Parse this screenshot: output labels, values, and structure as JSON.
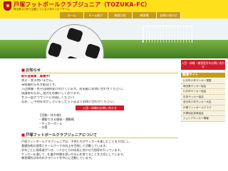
{
  "header": {
    "title": "戸塚フットボールクラブジュニア（TOZUKA-FC）",
    "subtitle": "埼玉県川口市で活動している少年サッカーチーム"
  },
  "nav": {
    "items": [
      "ホーム",
      "チーム紹介",
      "練習日程",
      "練習場",
      "お問い合わせ"
    ]
  },
  "news": {
    "heading": "お知らせ",
    "lines": [
      {
        "text": "新年度募集　募集中!",
        "title": true
      },
      {
        "text": "男子・女子問いません。",
        "title": false
      },
      {
        "text": "未経験の方も大歓迎です。",
        "title": false
      },
      {
        "text": "入団体験・見学は随時受け付けています。お気軽にお問い合わせください。",
        "title": false
      },
      {
        "text": "保護者の方のご協力をお願いしております。",
        "title": false
      },
      {
        "text": "ぜひ一度グラウンドにお越しください!",
        "title": false
      },
      {
        "text": "なお、ご不明な点がございましたら下記よりお問い合わせください。",
        "title": false
      }
    ],
    "button": "入団・体験のお問い合わせ"
  },
  "list": {
    "items": [
      "【活動・持ち物】",
      "・運動できる服装・運動靴",
      "・サッカーボール",
      "・水筒"
    ]
  },
  "about": {
    "heading": "戸塚フットボールクラブジュニアについて",
    "lines": [
      "戸塚フットボールクラブジュニアは、子供たちがサッカーを楽しむことを大切にし、",
      "基礎技術の習得とチームワークの向上を目指して活動しています。",
      "学年ごとに指導者がつき、一人ひとりの成長に合わせた指導を行っています。",
      "サッカーを通して、礼儀や仲間を思いやる心を育てることを大切にしています。",
      "練習場所は市内のグラウンドを中心に活動しています。"
    ]
  },
  "sidebar": {
    "button": "入団・体験・練習見学のお問い合わせ",
    "heading": "関連サイト",
    "links": [
      "川口市少年サッカー連盟",
      "埼玉県サッカー協会",
      "川口市サッカー協会",
      "日本サッカー協会",
      "全日本少年サッカー大会",
      "戸塚フットボールクラブ",
      "戸塚地区体育協会",
      "ジュニアサッカー情報"
    ]
  },
  "colors": {
    "brand": "#c8102e",
    "accent": "#ffe01a",
    "nav": "#c89a18"
  }
}
